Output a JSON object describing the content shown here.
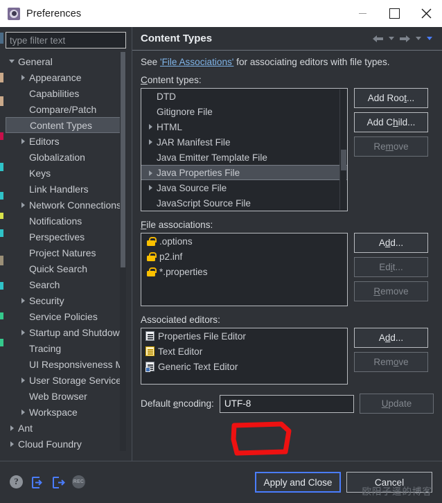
{
  "window": {
    "title": "Preferences",
    "icon": "preferences-gear-icon",
    "controls": {
      "minimize": "minimize-icon",
      "maximize": "maximize-icon",
      "close": "close-icon"
    }
  },
  "sidebar": {
    "filter": {
      "placeholder": "type filter text",
      "value": ""
    },
    "items": [
      {
        "label": "General",
        "indent": 0,
        "twisty": "open"
      },
      {
        "label": "Appearance",
        "indent": 1,
        "twisty": "closed"
      },
      {
        "label": "Capabilities",
        "indent": 1,
        "twisty": "none"
      },
      {
        "label": "Compare/Patch",
        "indent": 1,
        "twisty": "none"
      },
      {
        "label": "Content Types",
        "indent": 1,
        "twisty": "none",
        "selected": true
      },
      {
        "label": "Editors",
        "indent": 1,
        "twisty": "closed"
      },
      {
        "label": "Globalization",
        "indent": 1,
        "twisty": "none"
      },
      {
        "label": "Keys",
        "indent": 1,
        "twisty": "none"
      },
      {
        "label": "Link Handlers",
        "indent": 1,
        "twisty": "none"
      },
      {
        "label": "Network Connections",
        "indent": 1,
        "twisty": "closed"
      },
      {
        "label": "Notifications",
        "indent": 1,
        "twisty": "none"
      },
      {
        "label": "Perspectives",
        "indent": 1,
        "twisty": "none"
      },
      {
        "label": "Project Natures",
        "indent": 1,
        "twisty": "none"
      },
      {
        "label": "Quick Search",
        "indent": 1,
        "twisty": "none"
      },
      {
        "label": "Search",
        "indent": 1,
        "twisty": "none"
      },
      {
        "label": "Security",
        "indent": 1,
        "twisty": "closed"
      },
      {
        "label": "Service Policies",
        "indent": 1,
        "twisty": "none"
      },
      {
        "label": "Startup and Shutdown",
        "indent": 1,
        "twisty": "closed"
      },
      {
        "label": "Tracing",
        "indent": 1,
        "twisty": "none"
      },
      {
        "label": "UI Responsiveness Monitoring",
        "indent": 1,
        "twisty": "none"
      },
      {
        "label": "User Storage Service",
        "indent": 1,
        "twisty": "closed"
      },
      {
        "label": "Web Browser",
        "indent": 1,
        "twisty": "none"
      },
      {
        "label": "Workspace",
        "indent": 1,
        "twisty": "closed"
      },
      {
        "label": "Ant",
        "indent": 0,
        "twisty": "closed"
      },
      {
        "label": "Cloud Foundry",
        "indent": 0,
        "twisty": "closed"
      }
    ]
  },
  "page": {
    "title": "Content Types",
    "nav": {
      "back": "back-arrow-icon",
      "back_menu": "chevron-down-icon",
      "forward": "forward-arrow-icon",
      "forward_menu": "chevron-down-icon",
      "view_menu": "chevron-down-icon"
    },
    "intro": {
      "prefix": "See ",
      "link": "'File Associations'",
      "suffix": " for associating editors with file types."
    },
    "content_types": {
      "label_pre": "C",
      "label_post": "ontent types:",
      "items": [
        {
          "label": "DTD",
          "twisty": "none"
        },
        {
          "label": "Gitignore File",
          "twisty": "none"
        },
        {
          "label": "HTML",
          "twisty": "closed"
        },
        {
          "label": "JAR Manifest File",
          "twisty": "closed"
        },
        {
          "label": "Java Emitter Template File",
          "twisty": "none"
        },
        {
          "label": "Java Properties File",
          "twisty": "closed",
          "selected": true
        },
        {
          "label": "Java Source File",
          "twisty": "closed"
        },
        {
          "label": "JavaScript Source File",
          "twisty": "none"
        }
      ],
      "buttons": [
        {
          "pre": "Add Roo",
          "key": "t",
          "post": "...",
          "disabled": false,
          "name": "add-root-button"
        },
        {
          "pre": "Add C",
          "key": "h",
          "post": "ild...",
          "disabled": false,
          "name": "add-child-button"
        },
        {
          "pre": "Re",
          "key": "m",
          "post": "ove",
          "disabled": true,
          "name": "remove-content-type-button"
        }
      ]
    },
    "file_associations": {
      "label_pre": "F",
      "label_post": "ile associations:",
      "items": [
        {
          "label": ".options",
          "icon": "lock-icon"
        },
        {
          "label": "p2.inf",
          "icon": "lock-icon"
        },
        {
          "label": "*.properties",
          "icon": "lock-icon"
        }
      ],
      "buttons": [
        {
          "pre": "A",
          "key": "d",
          "post": "d...",
          "disabled": false,
          "name": "add-file-association-button"
        },
        {
          "pre": "Ed",
          "key": "i",
          "post": "t...",
          "disabled": true,
          "name": "edit-file-association-button"
        },
        {
          "pre": "",
          "key": "R",
          "post": "emove",
          "disabled": true,
          "name": "remove-file-association-button"
        }
      ]
    },
    "associated_editors": {
      "label": "Associated editors:",
      "items": [
        {
          "label": "Properties File Editor",
          "icon": "document-icon"
        },
        {
          "label": "Text Editor",
          "icon": "text-document-icon"
        },
        {
          "label": "Generic Text Editor",
          "icon": "generic-document-icon"
        }
      ],
      "buttons": [
        {
          "pre": "A",
          "key": "d",
          "post": "d...",
          "disabled": false,
          "name": "add-editor-button"
        },
        {
          "pre": "Rem",
          "key": "o",
          "post": "ve",
          "disabled": true,
          "name": "remove-editor-button"
        }
      ]
    },
    "default_encoding": {
      "label_pre": "Default ",
      "label_key": "e",
      "label_post": "ncoding:",
      "value": "UTF-8",
      "button": {
        "pre": "",
        "key": "U",
        "post": "pdate",
        "disabled": true
      }
    },
    "annotation": {
      "shape": "red-rectangle-highlight",
      "color": "#ee1111",
      "target": "UTF-8"
    }
  },
  "footer": {
    "icons": [
      {
        "name": "help-icon",
        "glyph": "?"
      },
      {
        "name": "import-icon",
        "glyph": ""
      },
      {
        "name": "export-icon",
        "glyph": ""
      },
      {
        "name": "record-icon",
        "glyph": "REC"
      }
    ],
    "apply_and_close": "Apply and Close",
    "cancel": "Cancel",
    "watermark": "欧阳子遥的博客"
  },
  "colors": {
    "accent": "#4a7dff",
    "link": "#7fb4e8",
    "lock": "#fcc100",
    "annotation": "#ee1111",
    "panel_bg": "#2f3237",
    "list_bg": "#24272c"
  }
}
